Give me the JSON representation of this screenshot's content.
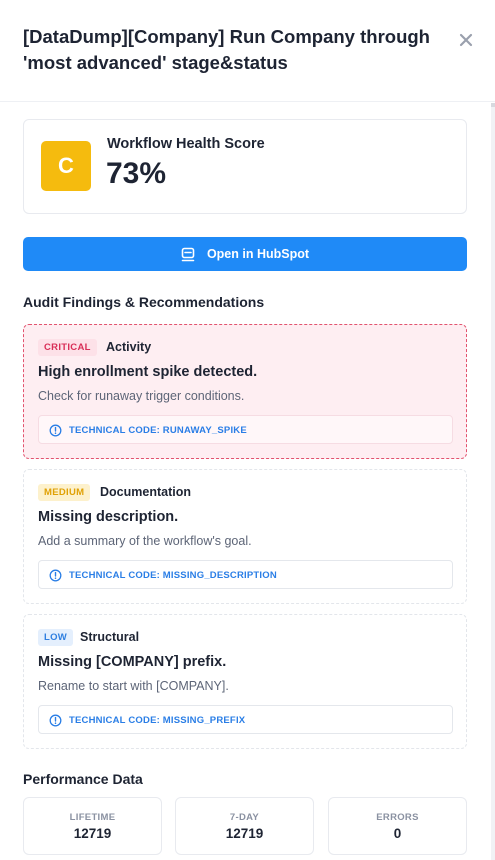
{
  "header": {
    "title_line1": "[DataDump][Company] Run Company through",
    "title_line2": "'most advanced' stage&status"
  },
  "health": {
    "grade": "C",
    "label": "Workflow Health Score",
    "value": "73%",
    "grade_color": "#f5bb0e"
  },
  "actions": {
    "open_hubspot": "Open in HubSpot",
    "accent": "#1f8af7"
  },
  "audit": {
    "title": "Audit Findings & Recommendations",
    "findings": [
      {
        "severity": "CRITICAL",
        "category": "Activity",
        "title": "High enrollment spike detected.",
        "description": "Check for runaway trigger conditions.",
        "code": "TECHNICAL CODE: RUNAWAY_SPIKE"
      },
      {
        "severity": "MEDIUM",
        "category": "Documentation",
        "title": "Missing description.",
        "description": "Add a summary of the workflow's goal.",
        "code": "TECHNICAL CODE: MISSING_DESCRIPTION"
      },
      {
        "severity": "LOW",
        "category": "Structural",
        "title": "Missing [COMPANY] prefix.",
        "description": "Rename to start with [COMPANY].",
        "code": "TECHNICAL CODE: MISSING_PREFIX"
      }
    ]
  },
  "performance": {
    "title": "Performance Data",
    "stats": [
      {
        "label": "LIFETIME",
        "value": "12719"
      },
      {
        "label": "7-DAY",
        "value": "12719"
      },
      {
        "label": "ERRORS",
        "value": "0"
      }
    ]
  }
}
